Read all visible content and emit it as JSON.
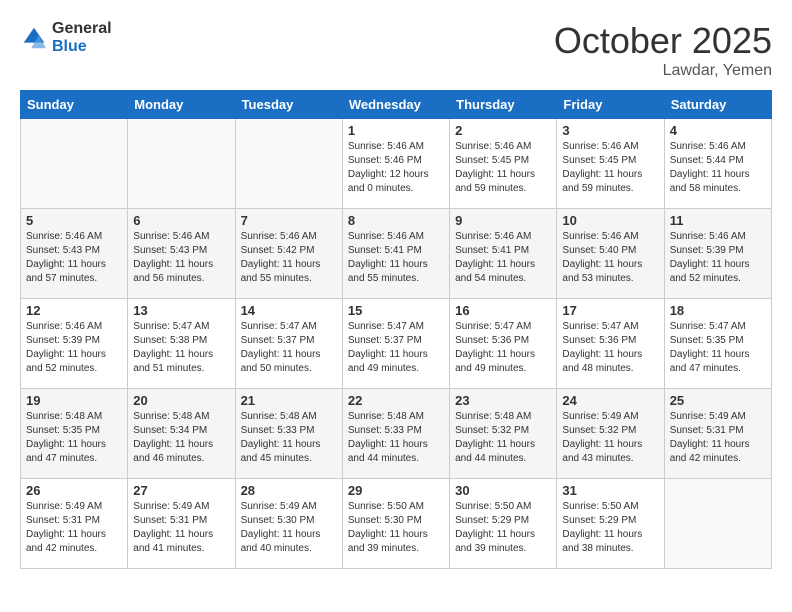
{
  "logo": {
    "general": "General",
    "blue": "Blue"
  },
  "title": "October 2025",
  "location": "Lawdar, Yemen",
  "weekdays": [
    "Sunday",
    "Monday",
    "Tuesday",
    "Wednesday",
    "Thursday",
    "Friday",
    "Saturday"
  ],
  "weeks": [
    [
      {
        "day": "",
        "sunrise": "",
        "sunset": "",
        "daylight": ""
      },
      {
        "day": "",
        "sunrise": "",
        "sunset": "",
        "daylight": ""
      },
      {
        "day": "",
        "sunrise": "",
        "sunset": "",
        "daylight": ""
      },
      {
        "day": "1",
        "sunrise": "Sunrise: 5:46 AM",
        "sunset": "Sunset: 5:46 PM",
        "daylight": "Daylight: 12 hours and 0 minutes."
      },
      {
        "day": "2",
        "sunrise": "Sunrise: 5:46 AM",
        "sunset": "Sunset: 5:45 PM",
        "daylight": "Daylight: 11 hours and 59 minutes."
      },
      {
        "day": "3",
        "sunrise": "Sunrise: 5:46 AM",
        "sunset": "Sunset: 5:45 PM",
        "daylight": "Daylight: 11 hours and 59 minutes."
      },
      {
        "day": "4",
        "sunrise": "Sunrise: 5:46 AM",
        "sunset": "Sunset: 5:44 PM",
        "daylight": "Daylight: 11 hours and 58 minutes."
      }
    ],
    [
      {
        "day": "5",
        "sunrise": "Sunrise: 5:46 AM",
        "sunset": "Sunset: 5:43 PM",
        "daylight": "Daylight: 11 hours and 57 minutes."
      },
      {
        "day": "6",
        "sunrise": "Sunrise: 5:46 AM",
        "sunset": "Sunset: 5:43 PM",
        "daylight": "Daylight: 11 hours and 56 minutes."
      },
      {
        "day": "7",
        "sunrise": "Sunrise: 5:46 AM",
        "sunset": "Sunset: 5:42 PM",
        "daylight": "Daylight: 11 hours and 55 minutes."
      },
      {
        "day": "8",
        "sunrise": "Sunrise: 5:46 AM",
        "sunset": "Sunset: 5:41 PM",
        "daylight": "Daylight: 11 hours and 55 minutes."
      },
      {
        "day": "9",
        "sunrise": "Sunrise: 5:46 AM",
        "sunset": "Sunset: 5:41 PM",
        "daylight": "Daylight: 11 hours and 54 minutes."
      },
      {
        "day": "10",
        "sunrise": "Sunrise: 5:46 AM",
        "sunset": "Sunset: 5:40 PM",
        "daylight": "Daylight: 11 hours and 53 minutes."
      },
      {
        "day": "11",
        "sunrise": "Sunrise: 5:46 AM",
        "sunset": "Sunset: 5:39 PM",
        "daylight": "Daylight: 11 hours and 52 minutes."
      }
    ],
    [
      {
        "day": "12",
        "sunrise": "Sunrise: 5:46 AM",
        "sunset": "Sunset: 5:39 PM",
        "daylight": "Daylight: 11 hours and 52 minutes."
      },
      {
        "day": "13",
        "sunrise": "Sunrise: 5:47 AM",
        "sunset": "Sunset: 5:38 PM",
        "daylight": "Daylight: 11 hours and 51 minutes."
      },
      {
        "day": "14",
        "sunrise": "Sunrise: 5:47 AM",
        "sunset": "Sunset: 5:37 PM",
        "daylight": "Daylight: 11 hours and 50 minutes."
      },
      {
        "day": "15",
        "sunrise": "Sunrise: 5:47 AM",
        "sunset": "Sunset: 5:37 PM",
        "daylight": "Daylight: 11 hours and 49 minutes."
      },
      {
        "day": "16",
        "sunrise": "Sunrise: 5:47 AM",
        "sunset": "Sunset: 5:36 PM",
        "daylight": "Daylight: 11 hours and 49 minutes."
      },
      {
        "day": "17",
        "sunrise": "Sunrise: 5:47 AM",
        "sunset": "Sunset: 5:36 PM",
        "daylight": "Daylight: 11 hours and 48 minutes."
      },
      {
        "day": "18",
        "sunrise": "Sunrise: 5:47 AM",
        "sunset": "Sunset: 5:35 PM",
        "daylight": "Daylight: 11 hours and 47 minutes."
      }
    ],
    [
      {
        "day": "19",
        "sunrise": "Sunrise: 5:48 AM",
        "sunset": "Sunset: 5:35 PM",
        "daylight": "Daylight: 11 hours and 47 minutes."
      },
      {
        "day": "20",
        "sunrise": "Sunrise: 5:48 AM",
        "sunset": "Sunset: 5:34 PM",
        "daylight": "Daylight: 11 hours and 46 minutes."
      },
      {
        "day": "21",
        "sunrise": "Sunrise: 5:48 AM",
        "sunset": "Sunset: 5:33 PM",
        "daylight": "Daylight: 11 hours and 45 minutes."
      },
      {
        "day": "22",
        "sunrise": "Sunrise: 5:48 AM",
        "sunset": "Sunset: 5:33 PM",
        "daylight": "Daylight: 11 hours and 44 minutes."
      },
      {
        "day": "23",
        "sunrise": "Sunrise: 5:48 AM",
        "sunset": "Sunset: 5:32 PM",
        "daylight": "Daylight: 11 hours and 44 minutes."
      },
      {
        "day": "24",
        "sunrise": "Sunrise: 5:49 AM",
        "sunset": "Sunset: 5:32 PM",
        "daylight": "Daylight: 11 hours and 43 minutes."
      },
      {
        "day": "25",
        "sunrise": "Sunrise: 5:49 AM",
        "sunset": "Sunset: 5:31 PM",
        "daylight": "Daylight: 11 hours and 42 minutes."
      }
    ],
    [
      {
        "day": "26",
        "sunrise": "Sunrise: 5:49 AM",
        "sunset": "Sunset: 5:31 PM",
        "daylight": "Daylight: 11 hours and 42 minutes."
      },
      {
        "day": "27",
        "sunrise": "Sunrise: 5:49 AM",
        "sunset": "Sunset: 5:31 PM",
        "daylight": "Daylight: 11 hours and 41 minutes."
      },
      {
        "day": "28",
        "sunrise": "Sunrise: 5:49 AM",
        "sunset": "Sunset: 5:30 PM",
        "daylight": "Daylight: 11 hours and 40 minutes."
      },
      {
        "day": "29",
        "sunrise": "Sunrise: 5:50 AM",
        "sunset": "Sunset: 5:30 PM",
        "daylight": "Daylight: 11 hours and 39 minutes."
      },
      {
        "day": "30",
        "sunrise": "Sunrise: 5:50 AM",
        "sunset": "Sunset: 5:29 PM",
        "daylight": "Daylight: 11 hours and 39 minutes."
      },
      {
        "day": "31",
        "sunrise": "Sunrise: 5:50 AM",
        "sunset": "Sunset: 5:29 PM",
        "daylight": "Daylight: 11 hours and 38 minutes."
      },
      {
        "day": "",
        "sunrise": "",
        "sunset": "",
        "daylight": ""
      }
    ]
  ]
}
